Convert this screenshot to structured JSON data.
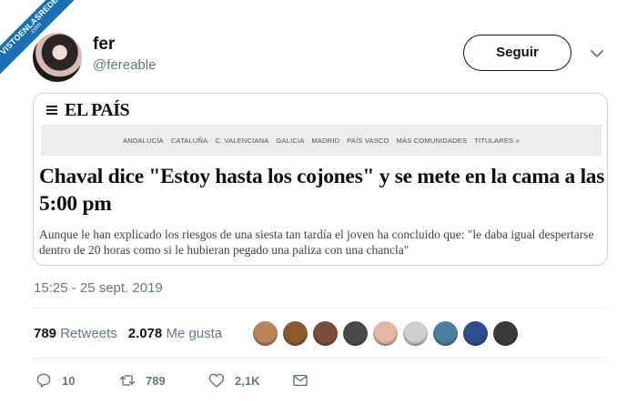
{
  "watermark": {
    "line1": "VISTOENLASREDES",
    "line2": ".com"
  },
  "tweet": {
    "author_name": "fer",
    "author_handle": "@fereable",
    "follow_label": "Seguir",
    "timestamp": "15:25 - 25 sept. 2019",
    "retweets_count": "789",
    "retweets_label": "Retweets",
    "likes_count": "2.078",
    "likes_label": "Me gusta"
  },
  "article": {
    "publication": "EL PAÍS",
    "regions": [
      "ANDALUCÍA",
      "CATALUÑA",
      "C. VALENCIANA",
      "GALICIA",
      "MADRID",
      "PAÍS VASCO",
      "MÁS COMUNIDADES",
      "TITULARES »"
    ],
    "headline": "Chaval dice \"Estoy hasta los cojones\" y se mete en la cama a las 5:00 pm",
    "subtitle": "Aunque le han explicado los riesgos de una siesta tan tardía el joven ha concluido que: \"le daba igual despertarse dentro de 20 horas como si le hubieran pegado una paliza con una chancla\""
  },
  "actions": {
    "reply_count": "10",
    "retweet_count": "789",
    "like_count": "2,1K"
  },
  "liker_colors": [
    "#b8845a",
    "#8a5a2e",
    "#7d4b3a",
    "#4a4a4a",
    "#e3b7a8",
    "#cfcfcf",
    "#4f7fa0",
    "#2f4c8f",
    "#3a3a3a"
  ],
  "colors": {
    "secondary_text": "#657786",
    "border": "#ccd6dd",
    "watermark": "#1b6fb0"
  }
}
